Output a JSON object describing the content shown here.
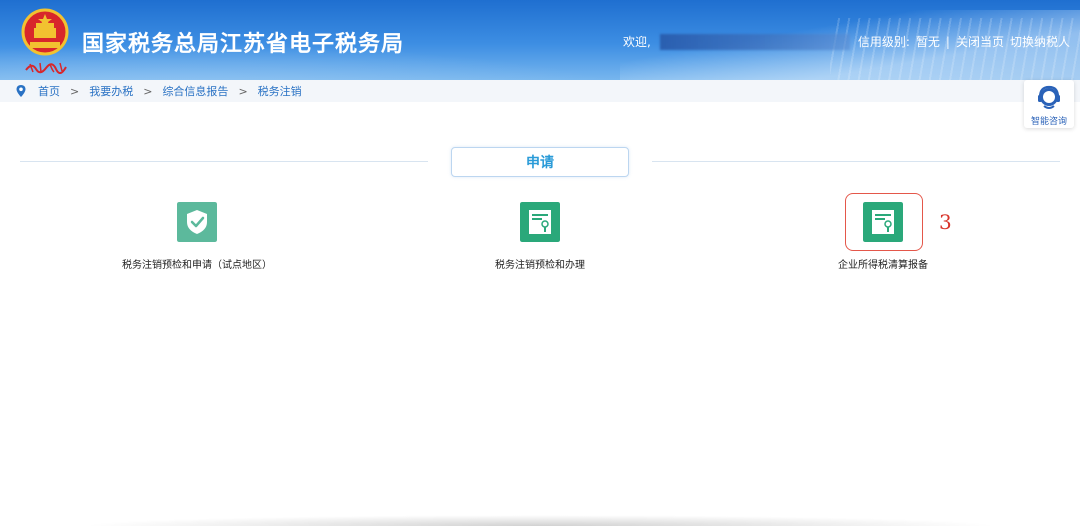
{
  "header": {
    "title": "国家税务总局江苏省电子税务局",
    "emblem_text": "中国税务",
    "welcome": "欢迎,",
    "credit_label": "信用级别:",
    "credit_value": "暂无",
    "separator": "|",
    "close_page": "关闭当页",
    "switch_taxpayer": "切换纳税人"
  },
  "breadcrumb": {
    "items": [
      "首页",
      "我要办税",
      "综合信息报告",
      "税务注销"
    ],
    "separator": ">"
  },
  "assistant": {
    "label": "智能咨询"
  },
  "section": {
    "title": "申请"
  },
  "cards": [
    {
      "label": "税务注销预检和申请（试点地区）",
      "icon": "shield-check-icon"
    },
    {
      "label": "税务注销预检和办理",
      "icon": "certificate-icon"
    },
    {
      "label": "企业所得税清算报备",
      "icon": "certificate-icon"
    }
  ],
  "annotation": {
    "text": "3",
    "color": "#d8342a"
  },
  "colors": {
    "header_blue": "#2f7fdc",
    "accent_teal": "#2aa87a",
    "link_blue": "#2a72c4",
    "section_text": "#2a9bd8"
  }
}
